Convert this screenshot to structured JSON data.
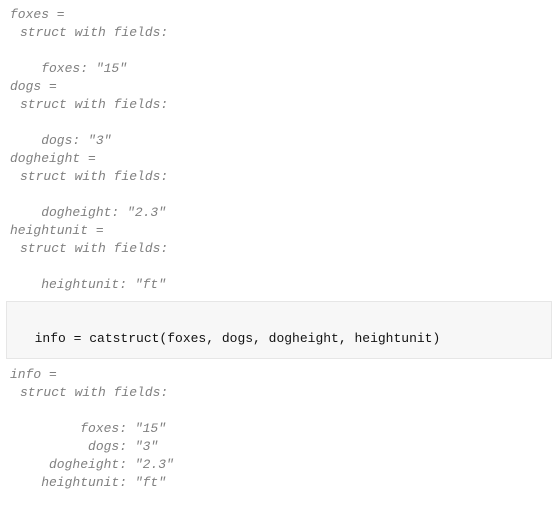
{
  "output1": {
    "varline": "foxes = ",
    "header": "struct with fields:",
    "field": "    foxes: \"15\""
  },
  "output2": {
    "varline": "dogs = ",
    "header": "struct with fields:",
    "field": "    dogs: \"3\""
  },
  "output3": {
    "varline": "dogheight = ",
    "header": "struct with fields:",
    "field": "    dogheight: \"2.3\""
  },
  "output4": {
    "varline": "heightunit = ",
    "header": "struct with fields:",
    "field": "    heightunit: \"ft\""
  },
  "code": {
    "line": "info = catstruct(foxes, dogs, dogheight, heightunit)"
  },
  "output5": {
    "varline": "info = ",
    "header": "struct with fields:",
    "f1": "         foxes: \"15\"",
    "f2": "          dogs: \"3\"",
    "f3": "     dogheight: \"2.3\"",
    "f4": "    heightunit: \"ft\""
  }
}
